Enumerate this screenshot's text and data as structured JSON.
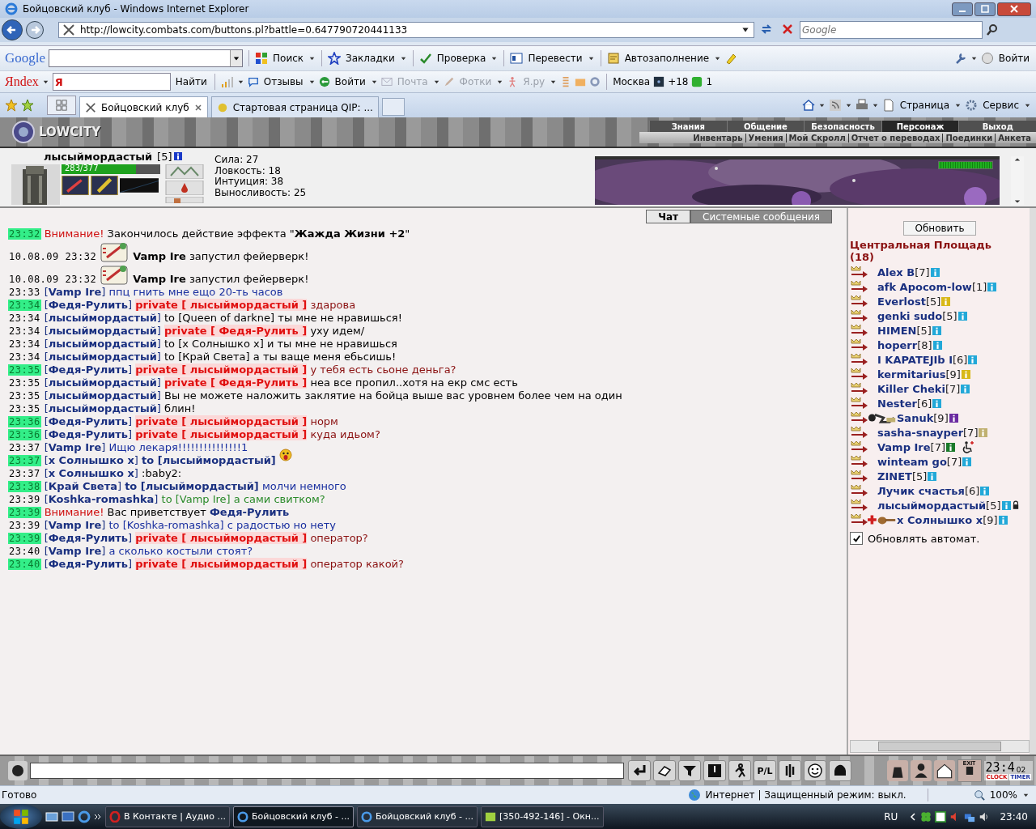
{
  "window": {
    "title": "Бойцовский клуб - Windows Internet Explorer"
  },
  "address_bar": {
    "url": "http://lowcity.combats.com/buttons.pl?battle=0.647790720441133",
    "search_placeholder": "Google"
  },
  "google_toolbar": {
    "logo": "Google",
    "buttons": [
      "Поиск",
      "Закладки",
      "Проверка",
      "Перевести",
      "Автозаполнение"
    ],
    "login": "Войти"
  },
  "yandex_toolbar": {
    "logo": "Яndex",
    "field_value": "Я",
    "find": "Найти",
    "items": [
      {
        "label": "Отзывы",
        "disabled": false
      },
      {
        "label": "Войти",
        "disabled": false
      },
      {
        "label": "Почта",
        "disabled": true
      },
      {
        "label": "Фотки",
        "disabled": true
      },
      {
        "label": "Я.ру",
        "disabled": true
      }
    ],
    "city": "Москва",
    "temperature": "+18",
    "traffic": "1"
  },
  "tabs": [
    {
      "label": "Бойцовский клуб",
      "selected": true
    },
    {
      "label": "Стартовая страница QIP: ...",
      "selected": false
    }
  ],
  "command_bar": [
    "Страница",
    "Сервис"
  ],
  "game": {
    "logo": "LOWCITY",
    "menu": [
      {
        "label": "Знания",
        "selected": false
      },
      {
        "label": "Общение",
        "selected": false
      },
      {
        "label": "Безопасность",
        "selected": false
      },
      {
        "label": "Персонаж",
        "selected": true
      },
      {
        "label": "Выход",
        "selected": false
      }
    ],
    "submenu": [
      "Инвентарь",
      "Умения",
      "Мой Скролл",
      "Отчет о переводах",
      "Поединки",
      "Анкета"
    ],
    "character": {
      "name": "лысыймордастый",
      "rank": "[5]",
      "health": {
        "text": "283/377",
        "level": 0.75
      },
      "stats": [
        "Сила: 27",
        "Ловкость: 18",
        "Интуиция: 38",
        "Выносливость: 25"
      ]
    },
    "banner_meter": {
      "level": 1
    },
    "chat_tabs": [
      {
        "label": "Чат",
        "selected": true
      },
      {
        "label": "Системные сообщения",
        "selected": false
      }
    ],
    "messages": [
      {
        "time": "23:32",
        "highlight": true,
        "parts": [
          {
            "kind": "alert",
            "text": "Внимание!"
          },
          {
            "kind": "plain",
            "text": "Закончилось действие эффекта \"**Жажда Жизни +2**\""
          }
        ]
      },
      {
        "time": "10.08.09 23:32",
        "highlight": false,
        "kind": "firework",
        "parts": [
          {
            "kind": "bold",
            "text": "Vamp Ire"
          },
          {
            "kind": "plain",
            "text": "запустил фейерверк!"
          }
        ]
      },
      {
        "time": "10.08.09 23:32",
        "highlight": false,
        "kind": "firework",
        "parts": [
          {
            "kind": "bold",
            "text": "Vamp Ire"
          },
          {
            "kind": "plain",
            "text": "запустил фейерверк!"
          }
        ]
      },
      {
        "time": "23:33",
        "highlight": false,
        "parts": [
          {
            "kind": "nick",
            "text": "[**Vamp Ire**]"
          },
          {
            "kind": "blue",
            "text": "ппц гнить мне ещо 20-ть часов"
          }
        ]
      },
      {
        "time": "23:34",
        "highlight": true,
        "parts": [
          {
            "kind": "nick",
            "text": "[**Федя-Рулить**]"
          },
          {
            "kind": "private",
            "text": "private [ лысыймордастый ]"
          },
          {
            "kind": "maroon",
            "text": "здарова"
          }
        ]
      },
      {
        "time": "23:34",
        "highlight": false,
        "parts": [
          {
            "kind": "nick",
            "text": "[**лысыймордастый**]"
          },
          {
            "kind": "plain",
            "text": "to [Queen of darkne] ты мне не нравишься!"
          }
        ]
      },
      {
        "time": "23:34",
        "highlight": false,
        "parts": [
          {
            "kind": "nick",
            "text": "[**лысыймордастый**]"
          },
          {
            "kind": "private",
            "text": "private [ Федя-Рулить ]"
          },
          {
            "kind": "plain",
            "text": "уху идем/"
          }
        ]
      },
      {
        "time": "23:34",
        "highlight": false,
        "parts": [
          {
            "kind": "nick",
            "text": "[**лысыймордастый**]"
          },
          {
            "kind": "plain",
            "text": "to [x Солнышко x] и ты мне не нравишься"
          }
        ]
      },
      {
        "time": "23:34",
        "highlight": false,
        "parts": [
          {
            "kind": "nick",
            "text": "[**лысыймордастый**]"
          },
          {
            "kind": "plain",
            "text": "to [Край Света] а ты ваще меня ебьсишь!"
          }
        ]
      },
      {
        "time": "23:35",
        "highlight": true,
        "parts": [
          {
            "kind": "nick",
            "text": "[**Федя-Рулить**]"
          },
          {
            "kind": "private",
            "text": "private [ лысыймордастый ]"
          },
          {
            "kind": "maroon",
            "text": "у тебя есть сьоне деньга?"
          }
        ]
      },
      {
        "time": "23:35",
        "highlight": false,
        "parts": [
          {
            "kind": "nick",
            "text": "[**лысыймордастый**]"
          },
          {
            "kind": "private",
            "text": "private [ Федя-Рулить ]"
          },
          {
            "kind": "plain",
            "text": "неа все пропил..хотя на екр смс есть"
          }
        ]
      },
      {
        "time": "23:35",
        "highlight": false,
        "parts": [
          {
            "kind": "nick",
            "text": "[**лысыймордастый**]"
          },
          {
            "kind": "plain",
            "text": "Вы не можете наложить заклятие на бойца выше вас уровнем более чем на один"
          }
        ]
      },
      {
        "time": "23:35",
        "highlight": false,
        "parts": [
          {
            "kind": "nick",
            "text": "[**лысыймордастый**]"
          },
          {
            "kind": "plain",
            "text": "блин!"
          }
        ]
      },
      {
        "time": "23:36",
        "highlight": true,
        "parts": [
          {
            "kind": "nick",
            "text": "[**Федя-Рулить**]"
          },
          {
            "kind": "private",
            "text": "private [ лысыймордастый ]"
          },
          {
            "kind": "maroon",
            "text": "норм"
          }
        ]
      },
      {
        "time": "23:36",
        "highlight": true,
        "parts": [
          {
            "kind": "nick",
            "text": "[**Федя-Рулить**]"
          },
          {
            "kind": "private",
            "text": "private [ лысыймордастый ]"
          },
          {
            "kind": "maroon",
            "text": "куда идьом?"
          }
        ]
      },
      {
        "time": "23:37",
        "highlight": false,
        "parts": [
          {
            "kind": "nick",
            "text": "[**Vamp Ire**]"
          },
          {
            "kind": "blue",
            "text": "Ищю лекаря!!!!!!!!!!!!!!!1"
          }
        ]
      },
      {
        "time": "23:37",
        "highlight": true,
        "kind": "emote",
        "parts": [
          {
            "kind": "nick",
            "text": "[**x Солнышко x**]"
          },
          {
            "kind": "bold",
            "text": "to [лысыймордастый]"
          }
        ]
      },
      {
        "time": "23:37",
        "highlight": false,
        "parts": [
          {
            "kind": "nick",
            "text": "[**x Солнышко x**]"
          },
          {
            "kind": "plain",
            "text": ":baby2:"
          }
        ]
      },
      {
        "time": "23:38",
        "highlight": true,
        "parts": [
          {
            "kind": "nick",
            "text": "[**Край Света**]"
          },
          {
            "kind": "bold",
            "text": "to [лысыймордастый]"
          },
          {
            "kind": "blue",
            "text": "молчи немного"
          }
        ]
      },
      {
        "time": "23:39",
        "highlight": false,
        "parts": [
          {
            "kind": "nick",
            "text": "[**Koshka-romashka**]"
          },
          {
            "kind": "green",
            "text": "to [Vamp Ire] а сами свитком?"
          }
        ]
      },
      {
        "time": "23:39",
        "highlight": true,
        "parts": [
          {
            "kind": "alert",
            "text": "Внимание!"
          },
          {
            "kind": "plain",
            "text": "Вас приветствует"
          },
          {
            "kind": "bold",
            "text": "Федя-Рулить"
          }
        ]
      },
      {
        "time": "23:39",
        "highlight": false,
        "parts": [
          {
            "kind": "nick",
            "text": "[**Vamp Ire**]"
          },
          {
            "kind": "blue",
            "text": "to [Koshka-romashka] с радостью но нету"
          }
        ]
      },
      {
        "time": "23:39",
        "highlight": true,
        "parts": [
          {
            "kind": "nick",
            "text": "[**Федя-Рулить**]"
          },
          {
            "kind": "private",
            "text": "private [ лысыймордастый ]"
          },
          {
            "kind": "maroon",
            "text": "оператор?"
          }
        ]
      },
      {
        "time": "23:40",
        "highlight": false,
        "parts": [
          {
            "kind": "nick",
            "text": "[**Vamp Ire**]"
          },
          {
            "kind": "blue",
            "text": "а сколько костыли стоят?"
          }
        ]
      },
      {
        "time": "23:40",
        "highlight": true,
        "parts": [
          {
            "kind": "nick",
            "text": "[**Федя-Рулить**]"
          },
          {
            "kind": "private",
            "text": "private [ лысыймордастый ]"
          },
          {
            "kind": "maroon",
            "text": "оператор какой?"
          }
        ]
      }
    ],
    "refresh_button": "Обновить",
    "location": "Центральная Площадь (18)",
    "users": [
      {
        "name": "Alex B",
        "rank": "[7]",
        "color": "#22a8d8"
      },
      {
        "name": "afk Apocom-low",
        "rank": "[1]",
        "color": "#22a8d8"
      },
      {
        "name": "Everlost",
        "rank": "[5]",
        "color": "#d8b818"
      },
      {
        "name": "genki sudo",
        "rank": "[5]",
        "color": "#22a8d8"
      },
      {
        "name": "HIMEN",
        "rank": "[5]",
        "color": "#22a8d8"
      },
      {
        "name": "hoperr",
        "rank": "[8]",
        "color": "#22a8d8"
      },
      {
        "name": "I KAPATEJIb I",
        "rank": "[6]",
        "color": "#22a8d8"
      },
      {
        "name": "kermitarius",
        "rank": "[9]",
        "color": "#d8b818"
      },
      {
        "name": "Killer Cheki",
        "rank": "[7]",
        "color": "#22a8d8"
      },
      {
        "name": "Nester",
        "rank": "[6]",
        "color": "#22a8d8"
      },
      {
        "name": "Sanuk",
        "rank": "[9]",
        "color": "#6a2aa0",
        "kind": "clan"
      },
      {
        "name": "sasha-snayper",
        "rank": "[7]",
        "color": "#c0b070"
      },
      {
        "name": "Vamp Ire",
        "rank": "[7]",
        "color": "#1a7a2a",
        "kind": "injured"
      },
      {
        "name": "winteam go",
        "rank": "[7]",
        "color": "#22a8d8"
      },
      {
        "name": "ZINET",
        "rank": "[5]",
        "color": "#22a8d8"
      },
      {
        "name": "Лучик счастья",
        "rank": "[6]",
        "color": "#22a8d8"
      },
      {
        "name": "лысыймордастый",
        "rank": "[5]",
        "color": "#22a8d8",
        "kind": "locked"
      },
      {
        "name": "x Солнышко x",
        "rank": "[9]",
        "color": "#22a8d8",
        "kind": "healer"
      }
    ],
    "auto_refresh": {
      "label": "Обновлять автомат.",
      "checked": true
    },
    "bottom_bar": {
      "pl_button": "P/L",
      "exit_label": "EXIT",
      "clock": "23:4",
      "clock_seconds": "02",
      "clock_label": "CLOCK",
      "timer_label": "TIMER"
    }
  },
  "status_bar": {
    "text": "Готово",
    "zone": "Интернет | Защищенный режим: выкл.",
    "zoom": "100%"
  },
  "taskbar": {
    "tasks": [
      {
        "label": "В Контакте | Аудио ...",
        "selected": false,
        "kind": "opera"
      },
      {
        "label": "Бойцовский клуб - ...",
        "selected": true,
        "kind": "ie"
      },
      {
        "label": "Бойцовский клуб - ...",
        "selected": false,
        "kind": "ie"
      },
      {
        "label": "[350-492-146] - Окн...",
        "selected": false,
        "kind": "chat"
      }
    ],
    "language": "RU",
    "time": "23:40"
  }
}
